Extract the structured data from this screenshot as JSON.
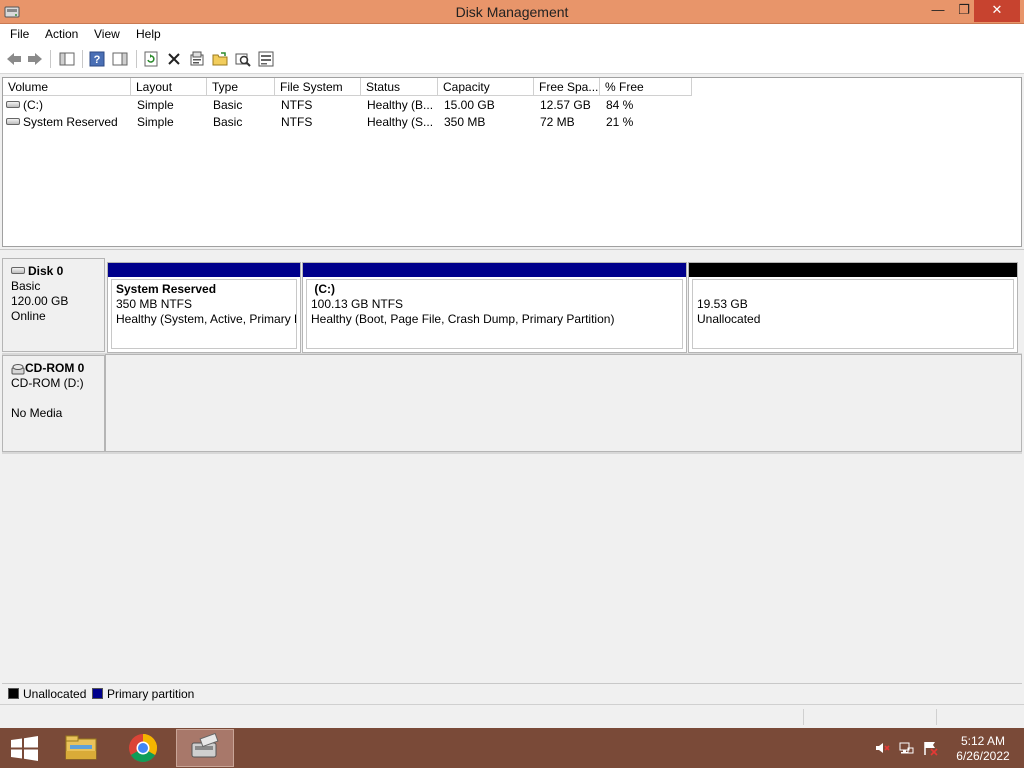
{
  "window": {
    "title": "Disk Management",
    "minimize_glyph": "—",
    "maximize_glyph": "❐",
    "close_glyph": "✕"
  },
  "menu": {
    "items": [
      "File",
      "Action",
      "View",
      "Help"
    ]
  },
  "toolbar": {
    "icons": [
      "back-icon",
      "forward-icon",
      "show-hide-console-tree-icon",
      "help-icon",
      "show-hide-action-pane-icon",
      "refresh-icon",
      "delete-icon",
      "properties-icon",
      "open-icon",
      "explore-icon",
      "rescan-disks-icon"
    ]
  },
  "volume_list": {
    "columns": [
      "Volume",
      "Layout",
      "Type",
      "File System",
      "Status",
      "Capacity",
      "Free Spa...",
      "% Free"
    ],
    "rows": [
      {
        "volume": "(C:)",
        "layout": "Simple",
        "type": "Basic",
        "file_system": "NTFS",
        "status": "Healthy (B...",
        "capacity": "15.00 GB",
        "free_space": "12.57 GB",
        "percent_free": "84 %"
      },
      {
        "volume": "System Reserved",
        "layout": "Simple",
        "type": "Basic",
        "file_system": "NTFS",
        "status": "Healthy (S...",
        "capacity": "350 MB",
        "free_space": "72 MB",
        "percent_free": "21 %"
      }
    ]
  },
  "disks": [
    {
      "name": "Disk 0",
      "type": "Basic",
      "size": "120.00 GB",
      "state": "Online",
      "partitions": [
        {
          "name": "System Reserved",
          "size": "350 MB NTFS",
          "status": "Healthy (System, Active, Primary P",
          "bar_color": "#00008b"
        },
        {
          "name": "(C:)",
          "size": "100.13 GB NTFS",
          "status": "Healthy (Boot, Page File, Crash Dump, Primary Partition)",
          "bar_color": "#00008b"
        },
        {
          "name": "",
          "size": "19.53 GB",
          "status": "Unallocated",
          "bar_color": "#000000"
        }
      ]
    }
  ],
  "cdrom": {
    "name": "CD-ROM 0",
    "drive": "CD-ROM (D:)",
    "state": "No Media"
  },
  "legend": [
    {
      "label": "Unallocated",
      "color": "#000000"
    },
    {
      "label": "Primary partition",
      "color": "#00008b"
    }
  ],
  "taskbar": {
    "apps": [
      "start-icon",
      "file-explorer-icon",
      "chrome-icon",
      "disk-management-icon"
    ],
    "tray_icons": [
      "volume-muted-icon",
      "network-icon",
      "action-center-icon"
    ],
    "time": "5:12 AM",
    "date": "6/26/2022"
  }
}
